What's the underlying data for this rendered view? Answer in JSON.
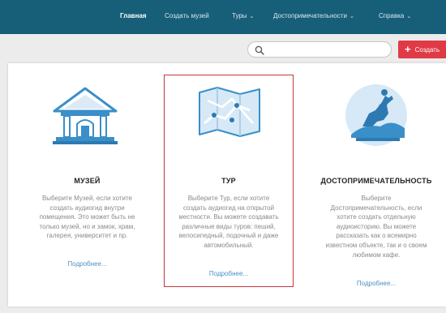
{
  "nav": {
    "items": [
      {
        "label": "Главная",
        "dropdown": false,
        "active": true
      },
      {
        "label": "Создать музей",
        "dropdown": false,
        "active": false
      },
      {
        "label": "Туры",
        "dropdown": true,
        "active": false
      },
      {
        "label": "Достопримечательности",
        "dropdown": true,
        "active": false
      },
      {
        "label": "Справка",
        "dropdown": true,
        "active": false
      }
    ]
  },
  "search": {
    "placeholder": "",
    "icon": "search-icon"
  },
  "create_button": {
    "label": "Создать",
    "icon": "plus-icon"
  },
  "colors": {
    "navbar": "#175f79",
    "accent_red": "#e03a47",
    "card_highlight": "#c2393c",
    "link": "#4a90c9",
    "illustration_blue": "#3a8fc9"
  },
  "cards": [
    {
      "icon": "museum-icon",
      "title": "МУЗЕЙ",
      "description": [
        "Выберите Музей, если хотите",
        "создать аудиогид внутри",
        "помещения. Это может быть не",
        "только музей, но и замок, храм,",
        "галерея, университет и пр."
      ],
      "more": "Подробнее..."
    },
    {
      "icon": "map-icon",
      "title": "ТУР",
      "description": [
        "Выберите Тур, если хотите",
        "создать аудиогид на открытой",
        "местности. Вы можете создавать",
        "различные виды туров: пеший,",
        "велосипедный, подочный и даже",
        "автомобильный."
      ],
      "more": "Подробнее...",
      "selected": true
    },
    {
      "icon": "monument-icon",
      "title": "ДОСТОПРИМЕЧАТЕЛЬНОСТЬ",
      "description": [
        "Выберите",
        "Достопримечательность, если",
        "хотите создать отдельную",
        "аудиоисторию. Вы можете",
        "рассказать как о всемирно",
        "известном объекте, так и о своем",
        "любимом кафе."
      ],
      "more": "Подробнее..."
    }
  ]
}
